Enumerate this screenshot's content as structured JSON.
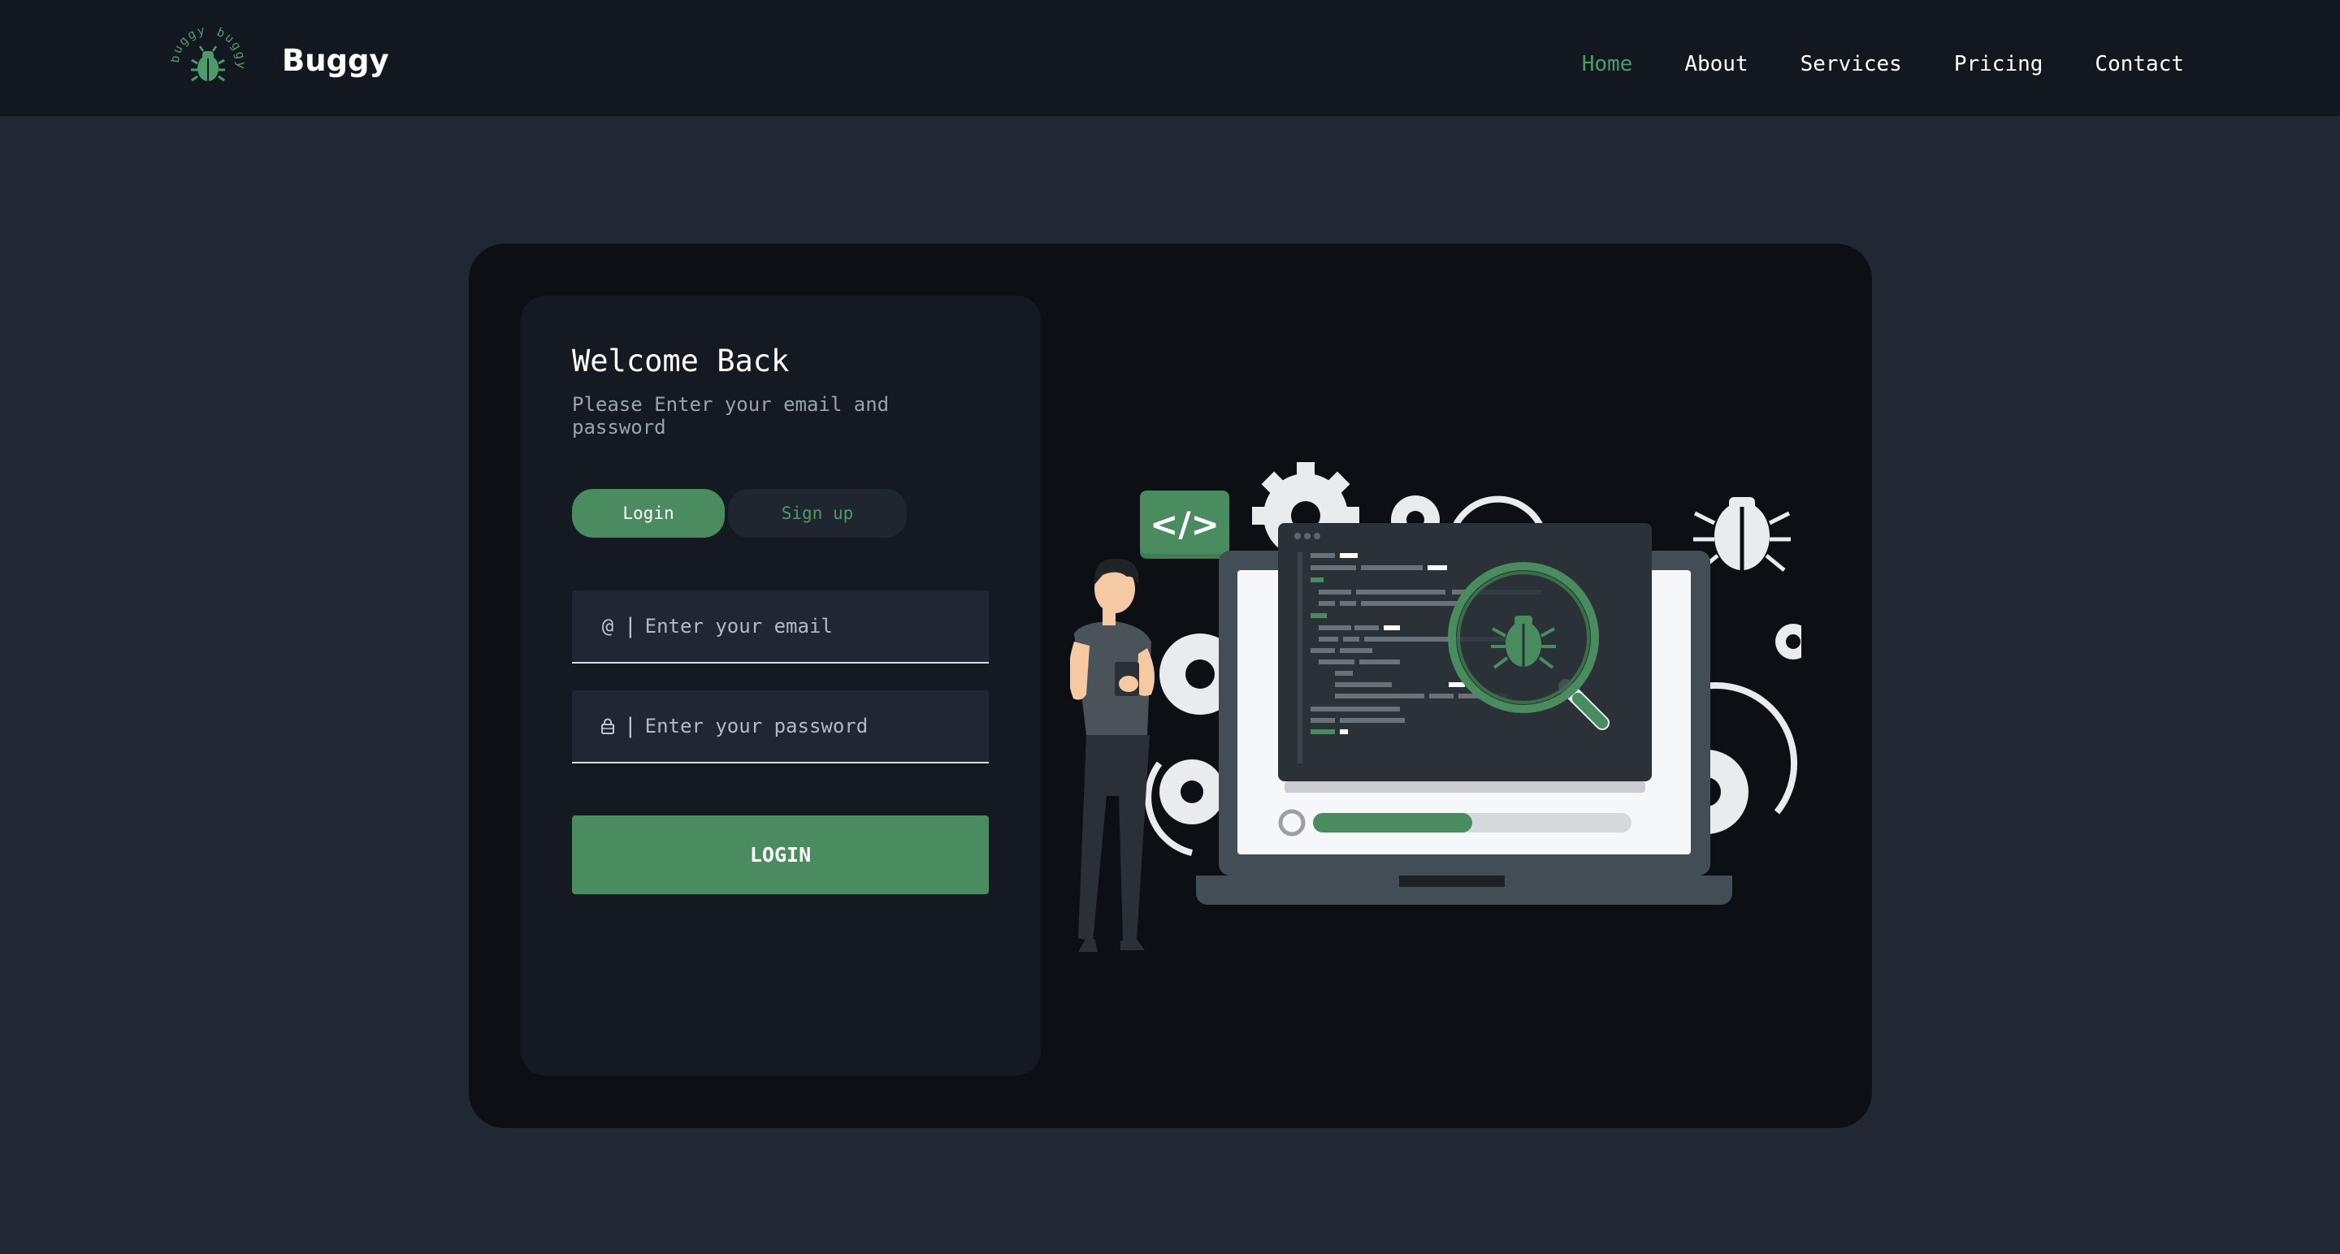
{
  "header": {
    "brand": "Buggy",
    "logo_ring_text": "buggy buggy",
    "nav": [
      {
        "label": "Home",
        "active": true
      },
      {
        "label": "About",
        "active": false
      },
      {
        "label": "Services",
        "active": false
      },
      {
        "label": "Pricing",
        "active": false
      },
      {
        "label": "Contact",
        "active": false
      }
    ]
  },
  "login_panel": {
    "title": "Welcome Back",
    "subtitle": "Please Enter your email and password",
    "tabs": {
      "login": "Login",
      "signup": "Sign up"
    },
    "email": {
      "icon": "at-icon",
      "placeholder": "Enter your email",
      "value": ""
    },
    "password": {
      "icon": "lock-icon",
      "placeholder": "Enter your password",
      "value": ""
    },
    "submit_label": "LOGIN"
  },
  "illustration": {
    "code_badge": "</>",
    "progress": 0.5
  },
  "colors": {
    "accent": "#4a8b5f",
    "accent_text": "#4f9a6b",
    "page_bg": "#212733",
    "topbar_bg": "#131820",
    "card_bg": "#0c0f14",
    "panel_bg": "#151a22"
  }
}
